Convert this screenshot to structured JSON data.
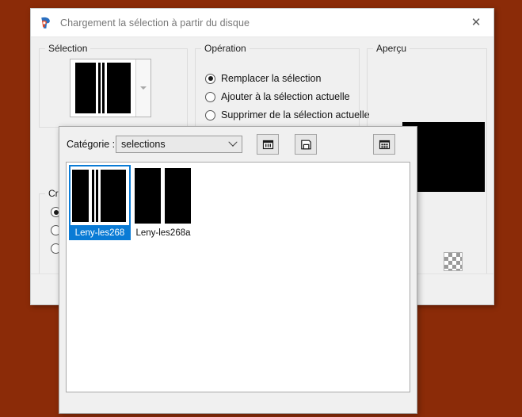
{
  "desktop": {
    "background_color": "#8b2b08"
  },
  "dialog": {
    "title": "Chargement la sélection à partir du disque",
    "app_icon": "paintshop-pro-icon",
    "close_label": "✕",
    "groups": {
      "selection": {
        "title": "Sélection"
      },
      "operation": {
        "title": "Opération",
        "options": [
          {
            "label": "Remplacer la sélection",
            "selected": true
          },
          {
            "label": "Ajouter à la sélection actuelle",
            "selected": false
          },
          {
            "label": "Supprimer de la sélection actuelle",
            "selected": false
          }
        ]
      },
      "apercu": {
        "title": "Aperçu"
      },
      "creer": {
        "title": "Crée",
        "options": [
          {
            "selected": true
          },
          {
            "selected": false
          },
          {
            "selected": false
          }
        ]
      }
    }
  },
  "browser": {
    "category_label": "Catégorie :",
    "category_value": "selections",
    "buttons": [
      {
        "name": "open-folder-button",
        "icon": "open-file-icon"
      },
      {
        "name": "save-button",
        "icon": "floppy-disk-icon"
      },
      {
        "name": "delete-button",
        "icon": "grid-delete-icon"
      }
    ],
    "files": [
      {
        "name": "Leny-les268",
        "selected": true
      },
      {
        "name": "Leny-les268a",
        "selected": false
      }
    ]
  },
  "accent_colors": {
    "selection_blue": "#0a7bd5",
    "dialog_face": "#f0f0f0",
    "titlebar": "#ffffff"
  }
}
